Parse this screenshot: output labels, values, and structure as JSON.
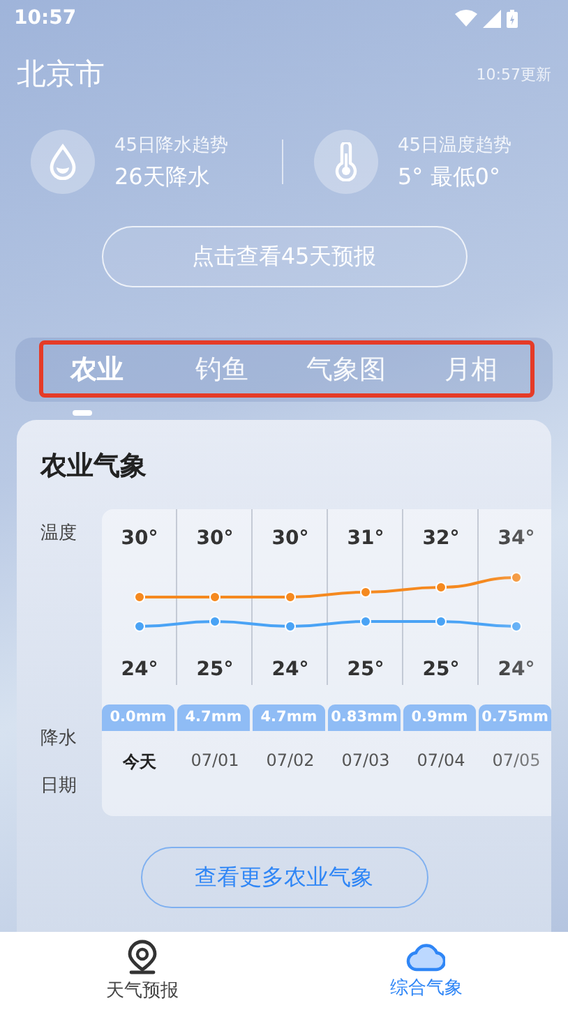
{
  "status_bar": {
    "time": "10:57"
  },
  "header": {
    "city": "北京市",
    "updated": "10:57更新"
  },
  "trends": [
    {
      "kind": "rain",
      "title": "45日降水趋势",
      "value": "26天降水"
    },
    {
      "kind": "temperature",
      "title": "45日温度趋势",
      "value": "5° 最低0°"
    }
  ],
  "forecast_button": "点击查看45天预报",
  "tabs": [
    {
      "label": "农业",
      "selected": true
    },
    {
      "label": "钓鱼",
      "selected": false
    },
    {
      "label": "气象图",
      "selected": false
    },
    {
      "label": "月相",
      "selected": false
    }
  ],
  "card": {
    "title": "农业气象",
    "row_labels": [
      "温度",
      "降水",
      "日期"
    ],
    "chart_data": {
      "type": "line",
      "series": [
        {
          "color": "#f5891f",
          "marker": true,
          "values": [
            30,
            30,
            30,
            31,
            32,
            34
          ],
          "value_labels": [
            "30°",
            "30°",
            "30°",
            "31°",
            "32°",
            "34°"
          ]
        },
        {
          "color": "#4aa3f5",
          "marker": true,
          "values": [
            24,
            25,
            24,
            25,
            25,
            24
          ],
          "value_labels": [
            "24°",
            "25°",
            "24°",
            "25°",
            "25°",
            "24°"
          ]
        }
      ]
    },
    "rain": [
      "0.0mm",
      "4.7mm",
      "4.7mm",
      "0.83mm",
      "0.9mm",
      "0.75mm"
    ],
    "dates": [
      {
        "label": "今天",
        "selected": true
      },
      {
        "label": "07/01",
        "selected": false
      },
      {
        "label": "07/02",
        "selected": false
      },
      {
        "label": "07/03",
        "selected": false
      },
      {
        "label": "07/04",
        "selected": false
      },
      {
        "label": "07/05",
        "selected": false
      }
    ],
    "more_button": "查看更多农业气象"
  },
  "bottom_nav": [
    {
      "kind": "pin",
      "label": "天气预报",
      "selected": false
    },
    {
      "kind": "cloud",
      "label": "综合气象",
      "selected": true
    }
  ]
}
